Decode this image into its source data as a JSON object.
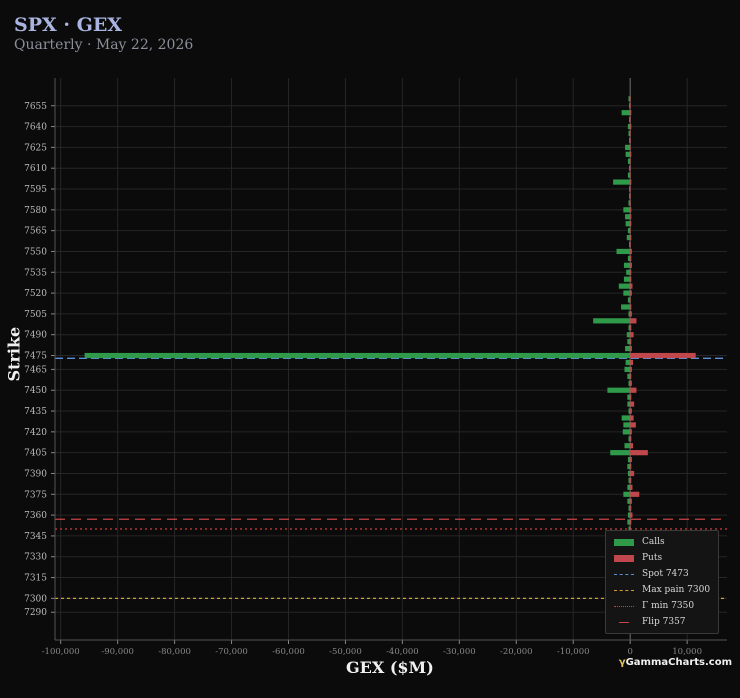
{
  "header": {
    "title": "SPX · GEX",
    "subtitle": "Quarterly · May 22, 2026"
  },
  "brand": {
    "symbol": "γ",
    "name": "GammaCharts.com"
  },
  "colors": {
    "calls": "#2e9a4a",
    "puts": "#c0474c",
    "spot": "#5d8fd6",
    "max_pain": "#d0a030",
    "gamma_min": "#d23c3c",
    "flip": "#c84444",
    "grid": "#262626",
    "background": "#0b0b0b"
  },
  "chart_data": {
    "type": "bar",
    "orientation": "horizontal",
    "xlabel": "GEX ($M)",
    "ylabel": "Strike",
    "xlim": [
      -101000,
      17000
    ],
    "ylim": [
      7270,
      7675
    ],
    "x_ticks": [
      -100000,
      -90000,
      -80000,
      -70000,
      -60000,
      -50000,
      -40000,
      -30000,
      -20000,
      -10000,
      0,
      10000
    ],
    "x_tick_labels": [
      "-100,000",
      "-90,000",
      "-80,000",
      "-70,000",
      "-60,000",
      "-50,000",
      "-40,000",
      "-30,000",
      "-20,000",
      "-10,000",
      "0",
      "10,000"
    ],
    "y_ticks": [
      7290,
      7300,
      7315,
      7330,
      7345,
      7360,
      7375,
      7390,
      7405,
      7420,
      7435,
      7450,
      7465,
      7475,
      7490,
      7505,
      7520,
      7535,
      7550,
      7565,
      7580,
      7595,
      7610,
      7625,
      7640,
      7655
    ],
    "grid": true,
    "legend_position": "bottom-right",
    "strikes": [
      7345,
      7350,
      7355,
      7360,
      7365,
      7370,
      7375,
      7380,
      7385,
      7390,
      7395,
      7400,
      7405,
      7410,
      7415,
      7420,
      7425,
      7430,
      7435,
      7440,
      7445,
      7450,
      7455,
      7460,
      7465,
      7470,
      7475,
      7480,
      7485,
      7490,
      7495,
      7500,
      7505,
      7510,
      7515,
      7520,
      7525,
      7530,
      7535,
      7540,
      7545,
      7550,
      7555,
      7560,
      7565,
      7570,
      7575,
      7580,
      7585,
      7590,
      7595,
      7600,
      7605,
      7610,
      7615,
      7620,
      7625,
      7630,
      7635,
      7640,
      7645,
      7650,
      7655,
      7660
    ],
    "series": [
      {
        "name": "Calls",
        "values": [
          -1200,
          -300,
          -500,
          -400,
          -300,
          -500,
          -1200,
          -500,
          -300,
          -400,
          -500,
          -400,
          -3500,
          -1000,
          -300,
          -1300,
          -1200,
          -1500,
          -300,
          -500,
          -500,
          -4000,
          -300,
          -500,
          -1000,
          -800,
          -95800,
          -900,
          -500,
          -600,
          -300,
          -6500,
          -300,
          -1600,
          -400,
          -1200,
          -2000,
          -1100,
          -700,
          -1100,
          -400,
          -2400,
          -200,
          -600,
          -400,
          -800,
          -900,
          -1200,
          -300,
          -200,
          -200,
          -3000,
          -400,
          -200,
          -400,
          -800,
          -900,
          -200,
          -300,
          -400,
          -200,
          -1500,
          -200,
          -300
        ]
      },
      {
        "name": "Puts",
        "values": [
          2000,
          100,
          200,
          400,
          200,
          300,
          1600,
          400,
          200,
          700,
          200,
          300,
          3100,
          500,
          200,
          300,
          1000,
          600,
          300,
          700,
          200,
          1100,
          300,
          200,
          300,
          500,
          11500,
          300,
          200,
          600,
          200,
          1100,
          300,
          200,
          100,
          300,
          400,
          200,
          200,
          300,
          200,
          300,
          100,
          200,
          100,
          200,
          200,
          200,
          100,
          100,
          100,
          200,
          100,
          100,
          100,
          200,
          100,
          100,
          100,
          200,
          100,
          200,
          100,
          100
        ]
      }
    ],
    "reference_lines": [
      {
        "name": "Spot 7473",
        "strike": 7473,
        "style": "dashed",
        "color": "#5d8fd6"
      },
      {
        "name": "Max pain 7300",
        "strike": 7300,
        "style": "dashed-fine",
        "color": "#d0a030"
      },
      {
        "name": "Γ min 7350",
        "strike": 7350,
        "style": "dotted",
        "color": "#d23c3c"
      },
      {
        "name": "Flip 7357",
        "strike": 7357,
        "style": "long-dash",
        "color": "#c84444"
      }
    ]
  }
}
